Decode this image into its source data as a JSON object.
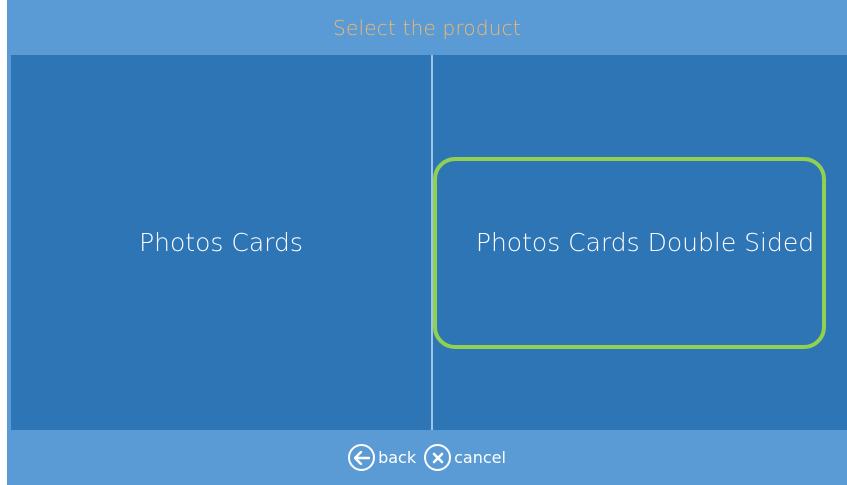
{
  "header": {
    "title": "Select the product"
  },
  "products": [
    {
      "label": "Photos Cards",
      "selected": false
    },
    {
      "label": "Photos Cards Double Sided",
      "selected": true
    }
  ],
  "footer": {
    "back_label": "back",
    "cancel_label": "cancel"
  },
  "icons": {
    "back": "arrow-left-circle-icon",
    "cancel": "x-circle-icon"
  },
  "colors": {
    "background": "#5b9bd5",
    "panel": "#2e75b6",
    "title": "#f0b86b",
    "selection": "#92d050"
  }
}
